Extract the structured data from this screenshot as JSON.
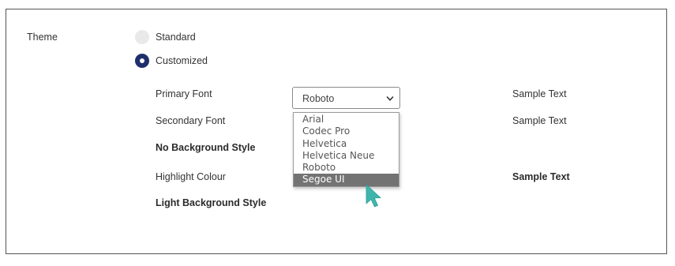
{
  "theme": {
    "label": "Theme",
    "options": [
      {
        "label": "Standard",
        "selected": false
      },
      {
        "label": "Customized",
        "selected": true
      }
    ]
  },
  "rows": {
    "primary_font_label": "Primary Font",
    "secondary_font_label": "Secondary Font",
    "no_background_style_label": "No Background Style",
    "highlight_colour_label": "Highlight Colour",
    "light_background_style_label": "Light Background Style"
  },
  "primary_font_select": {
    "value": "Roboto",
    "options": [
      "Arial",
      "Codec Pro",
      "Helvetica",
      "Helvetica Neue",
      "Roboto",
      "Segoe UI"
    ],
    "highlighted": "Segoe UI"
  },
  "samples": {
    "primary": "Sample Text",
    "secondary": "Sample Text",
    "highlight": "Sample Text"
  },
  "colors": {
    "radio_selected": "#1f2f6b",
    "radio_unselected": "#e9e9e9",
    "option_highlight": "#737373",
    "cursor": "#3fb6ad"
  },
  "icons": {
    "caret": "chevron-down-icon",
    "cursor": "mouse-pointer-icon"
  }
}
